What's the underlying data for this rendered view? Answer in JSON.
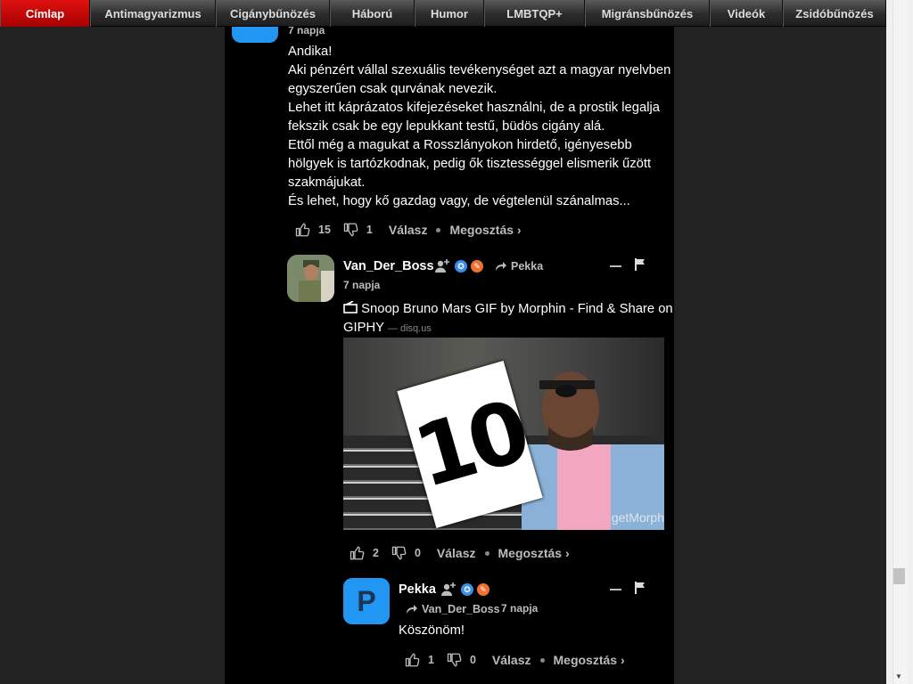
{
  "nav": {
    "items": [
      {
        "label": "Címlap",
        "active": true
      },
      {
        "label": "Antimagyarizmus"
      },
      {
        "label": "Cigánybűnözés"
      },
      {
        "label": "Háború"
      },
      {
        "label": "Humor"
      },
      {
        "label": "LMBTQP+"
      },
      {
        "label": "Migránsbűnözés"
      },
      {
        "label": "Videók"
      },
      {
        "label": "Zsidóbűnözés"
      }
    ],
    "active_color": "#cc0000"
  },
  "comment1": {
    "timestamp": "7 napja",
    "lines": [
      "Andika!",
      "Aki pénzért vállal szexuális tevékenységet azt a magyar nyelvben egyszerűen csak qurvának nevezik.",
      "Lehet itt káprázatos kifejezéseket használni, de a prostik legalja fekszik csak be egy lepukkant testű, büdös cigány alá.",
      "Ettől még a magukat a Rosszlányokon hirdető, igényesebb hölgyek is tartózkodnak, pedig ők tisztességgel elismerik űzött szakmájukat.",
      "És lehet, hogy kő gazdag vagy, de végtelenül szánalmas..."
    ],
    "upvotes": "15",
    "downvotes": "1",
    "reply_label": "Válasz",
    "share_label": "Megosztás ›"
  },
  "comment2": {
    "author": "Van_Der_Boss",
    "reply_to": "Pekka",
    "timestamp": "7 napja",
    "link_title": "Snoop Bruno Mars GIF by Morphin - Find & Share on GIPHY",
    "link_source": "— disq.us",
    "gif_card_text": "10",
    "gif_watermark": "getMorph",
    "upvotes": "2",
    "downvotes": "0",
    "reply_label": "Válasz",
    "share_label": "Megosztás ›"
  },
  "comment3": {
    "author": "Pekka",
    "avatar_letter": "P",
    "reply_to": "Van_Der_Boss",
    "timestamp": "7 napja",
    "message": "Köszönöm!",
    "upvotes": "1",
    "downvotes": "0",
    "reply_label": "Válasz",
    "share_label": "Megosztás ›"
  },
  "icons": {
    "upvote": "thumbs-up-icon",
    "downvote": "thumbs-down-icon",
    "follow": "add-user-icon",
    "collapse": "minus-icon",
    "flag": "flag-icon",
    "reply_arrow": "share-arrow-icon",
    "link": "link-card-icon"
  },
  "colors": {
    "avatar_blue": "#2196f3",
    "badge_blue": "#3b8ee8",
    "badge_orange": "#f07030"
  }
}
